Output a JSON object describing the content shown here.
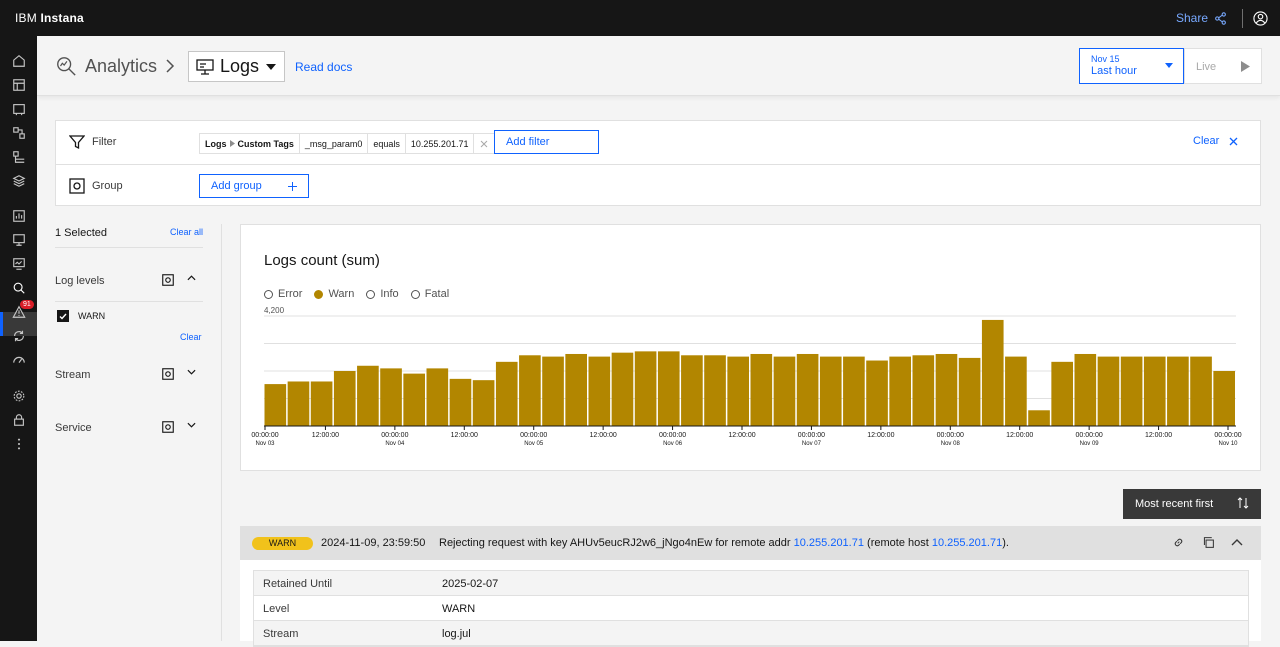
{
  "topbar": {
    "brand_prefix": "IBM",
    "brand_name": "Instana",
    "share_label": "Share"
  },
  "sidenav": {
    "alert_count": "91"
  },
  "header": {
    "title": "Analytics",
    "view_selector": "Logs",
    "read_docs": "Read docs",
    "time_date": "Nov 15",
    "time_range": "Last hour",
    "live_label": "Live"
  },
  "filter": {
    "label": "Filter",
    "chips": [
      "Logs",
      "Custom Tags",
      "_msg_param0",
      "equals",
      "10.255.201.71"
    ],
    "add_filter": "Add filter",
    "clear": "Clear"
  },
  "group": {
    "label": "Group",
    "add_group": "Add group"
  },
  "left_panel": {
    "selected": "1 Selected",
    "clear_all": "Clear all",
    "log_levels": "Log levels",
    "warn_option": "WARN",
    "clear": "Clear",
    "stream": "Stream",
    "service": "Service"
  },
  "chart_data": {
    "type": "bar",
    "title": "Logs count (sum)",
    "legend": [
      {
        "name": "Error",
        "active": false
      },
      {
        "name": "Warn",
        "active": true
      },
      {
        "name": "Info",
        "active": false
      },
      {
        "name": "Fatal",
        "active": false
      }
    ],
    "y_tick_top": "4,200",
    "ylim": [
      0,
      4200
    ],
    "bar_color": "#b28600",
    "values": [
      1600,
      1700,
      1700,
      2100,
      2300,
      2200,
      2000,
      2200,
      1800,
      1750,
      2450,
      2700,
      2650,
      2750,
      2650,
      2800,
      2850,
      2850,
      2700,
      2700,
      2650,
      2750,
      2650,
      2750,
      2650,
      2650,
      2500,
      2650,
      2700,
      2750,
      2600,
      4050,
      2650,
      600,
      2450,
      2750,
      2650,
      2650,
      2650,
      2650,
      2650,
      2100
    ],
    "x_ticks": [
      {
        "t": "00:00:00",
        "d": "Nov 03"
      },
      {
        "t": "12:00:00",
        "d": ""
      },
      {
        "t": "00:00:00",
        "d": "Nov 04"
      },
      {
        "t": "12:00:00",
        "d": ""
      },
      {
        "t": "00:00:00",
        "d": "Nov 05"
      },
      {
        "t": "12:00:00",
        "d": ""
      },
      {
        "t": "00:00:00",
        "d": "Nov 06"
      },
      {
        "t": "12:00:00",
        "d": ""
      },
      {
        "t": "00:00:00",
        "d": "Nov 07"
      },
      {
        "t": "12:00:00",
        "d": ""
      },
      {
        "t": "00:00:00",
        "d": "Nov 08"
      },
      {
        "t": "12:00:00",
        "d": ""
      },
      {
        "t": "00:00:00",
        "d": "Nov 09"
      },
      {
        "t": "12:00:00",
        "d": ""
      },
      {
        "t": "00:00:00",
        "d": "Nov 10"
      }
    ]
  },
  "sort": {
    "label": "Most recent first"
  },
  "log_entry": {
    "level": "WARN",
    "timestamp": "2024-11-09, 23:59:50",
    "msg_part1": "Rejecting request with key AHUv5eucRJ2w6_jNgo4nEw for remote addr ",
    "ip1": "10.255.201.71",
    "msg_part2": " (remote host ",
    "ip2": "10.255.201.71",
    "msg_part3": ")."
  },
  "details": [
    {
      "key": "Retained Until",
      "value": "2025-02-07"
    },
    {
      "key": "Level",
      "value": "WARN"
    },
    {
      "key": "Stream",
      "value": "log.jul"
    }
  ]
}
